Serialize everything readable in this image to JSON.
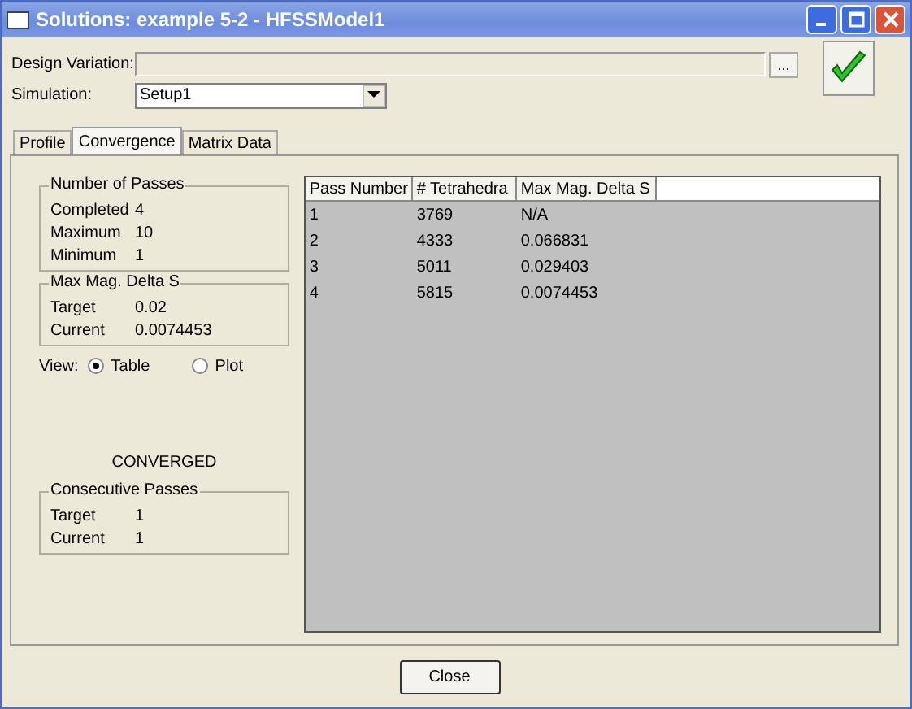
{
  "window": {
    "title": "Solutions: example 5-2 - HFSSModel1"
  },
  "design_variation": {
    "label": "Design Variation:",
    "browse": "..."
  },
  "simulation": {
    "label": "Simulation:",
    "value": "Setup1"
  },
  "tabs": [
    {
      "label": "Profile",
      "selected": false
    },
    {
      "label": "Convergence",
      "selected": true
    },
    {
      "label": "Matrix Data",
      "selected": false
    }
  ],
  "number_of_passes": {
    "title": "Number of Passes",
    "rows": [
      {
        "label": "Completed",
        "value": "4"
      },
      {
        "label": "Maximum",
        "value": "10"
      },
      {
        "label": "Minimum",
        "value": "1"
      }
    ]
  },
  "max_mag_delta_s": {
    "title": "Max Mag. Delta S",
    "rows": [
      {
        "label": "Target",
        "value": "0.02"
      },
      {
        "label": "Current",
        "value": "0.0074453"
      }
    ]
  },
  "view": {
    "label": "View:",
    "options": [
      {
        "label": "Table",
        "selected": true
      },
      {
        "label": "Plot",
        "selected": false
      }
    ]
  },
  "status": "CONVERGED",
  "consecutive_passes": {
    "title": "Consecutive Passes",
    "rows": [
      {
        "label": "Target",
        "value": "1"
      },
      {
        "label": "Current",
        "value": "1"
      }
    ]
  },
  "table": {
    "columns": [
      "Pass Number",
      "# Tetrahedra",
      "Max Mag. Delta S"
    ],
    "rows": [
      [
        "1",
        "3769",
        "N/A"
      ],
      [
        "2",
        "4333",
        "0.066831"
      ],
      [
        "3",
        "5011",
        "0.029403"
      ],
      [
        "4",
        "5815",
        "0.0074453"
      ]
    ]
  },
  "buttons": [
    "Close"
  ]
}
